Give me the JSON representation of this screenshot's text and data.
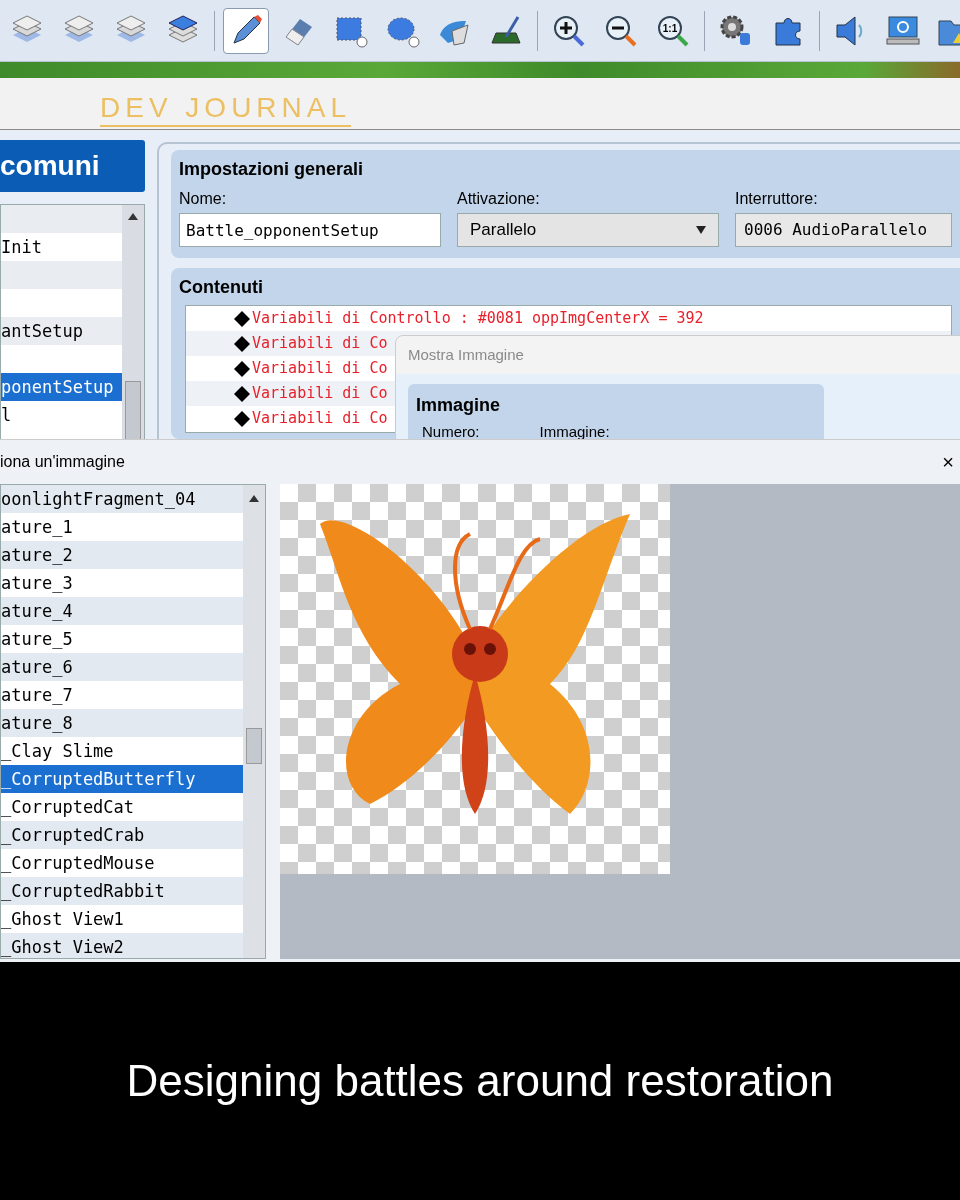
{
  "toolbar": [
    {
      "kind": "layer",
      "selected": false
    },
    {
      "kind": "layer",
      "selected": false
    },
    {
      "kind": "layer",
      "selected": false
    },
    {
      "kind": "layer-top",
      "selected": false
    },
    {
      "kind": "pencil",
      "selected": true
    },
    {
      "kind": "eraser",
      "selected": false
    },
    {
      "kind": "rectangle",
      "selected": false
    },
    {
      "kind": "ellipse",
      "selected": false
    },
    {
      "kind": "fill",
      "selected": false
    },
    {
      "kind": "shadow",
      "selected": false
    },
    {
      "kind": "zoom-in",
      "selected": false
    },
    {
      "kind": "zoom-out",
      "selected": false
    },
    {
      "kind": "zoom-actual",
      "label": "1:1",
      "selected": false
    },
    {
      "kind": "gears",
      "selected": false
    },
    {
      "kind": "puzzle",
      "selected": false
    },
    {
      "kind": "speaker",
      "selected": false
    },
    {
      "kind": "monitor",
      "selected": false
    },
    {
      "kind": "folder",
      "selected": false
    }
  ],
  "header": {
    "brand": "DEV JOURNAL"
  },
  "common_events": {
    "title": "comuni",
    "rows": [
      {
        "selected": false
      },
      {
        "text": "Init",
        "selected": false
      },
      {
        "selected": false
      },
      {
        "selected": false
      },
      {
        "text": "antSetup",
        "selected": false
      },
      {
        "selected": false
      },
      {
        "text": "ponentSetup",
        "selected": true
      },
      {
        "text": "l",
        "selected": false
      }
    ]
  },
  "general": {
    "title": "Impostazioni generali",
    "name_label": "Nome:",
    "name_value": "Battle_opponentSetup",
    "trigger_label": "Attivazione:",
    "trigger_value": "Parallelo",
    "switch_label": "Interruttore:",
    "switch_value": "0006 AudioParallelo"
  },
  "contents": {
    "title": "Contenuti",
    "rows": [
      "Variabili di Controllo : #0081 oppImgCenterX = 392",
      "Variabili di Co",
      "Variabili di Co",
      "Variabili di Co",
      "Variabili di Co"
    ]
  },
  "show_picture": {
    "title": "Mostra Immagine",
    "group": "Immagine",
    "number_label": "Numero:",
    "picture_label": "Immagine:"
  },
  "picker": {
    "title": "iona un'immagine",
    "close": "×",
    "files": [
      {
        "name": "oonlightFragment_04",
        "selected": false
      },
      {
        "name": "ature_1",
        "selected": false
      },
      {
        "name": "ature_2",
        "selected": false
      },
      {
        "name": "ature_3",
        "selected": false
      },
      {
        "name": "ature_4",
        "selected": false
      },
      {
        "name": "ature_5",
        "selected": false
      },
      {
        "name": "ature_6",
        "selected": false
      },
      {
        "name": "ature_7",
        "selected": false
      },
      {
        "name": "ature_8",
        "selected": false
      },
      {
        "name": "_Clay Slime",
        "selected": false
      },
      {
        "name": "_CorruptedButterfly",
        "selected": true
      },
      {
        "name": "_CorruptedCat",
        "selected": false
      },
      {
        "name": "_CorruptedCrab",
        "selected": false
      },
      {
        "name": "_CorruptedMouse",
        "selected": false
      },
      {
        "name": "_CorruptedRabbit",
        "selected": false
      },
      {
        "name": "_Ghost View1",
        "selected": false
      },
      {
        "name": "_Ghost View2",
        "selected": false
      }
    ]
  },
  "caption": "Designing battles around restoration"
}
